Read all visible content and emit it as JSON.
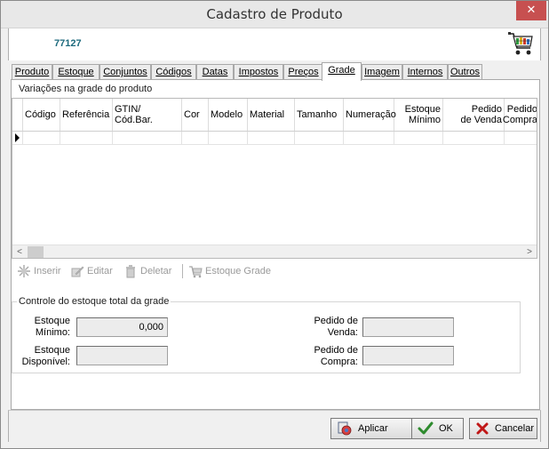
{
  "window": {
    "title": "Cadastro de Produto",
    "close_glyph": "✕"
  },
  "header": {
    "product_code": "77127",
    "icon": "shopping-cart-icon"
  },
  "tabs": [
    {
      "label": "Produto",
      "active": false
    },
    {
      "label": "Estoque",
      "active": false
    },
    {
      "label": "Conjuntos",
      "active": false
    },
    {
      "label": "Códigos",
      "active": false
    },
    {
      "label": "Datas",
      "active": false
    },
    {
      "label": "Impostos",
      "active": false
    },
    {
      "label": "Preços",
      "active": false
    },
    {
      "label": "Grade",
      "active": true
    },
    {
      "label": "Imagem",
      "active": false
    },
    {
      "label": "Internos",
      "active": false
    },
    {
      "label": "Outros",
      "active": false
    }
  ],
  "variations": {
    "group_title": "Variações na grade do produto",
    "columns": [
      {
        "label": "Código"
      },
      {
        "label": "Referência"
      },
      {
        "label": "GTIN/\nCód.Bar."
      },
      {
        "label": "Cor"
      },
      {
        "label": "Modelo"
      },
      {
        "label": "Material"
      },
      {
        "label": "Tamanho"
      },
      {
        "label": "Numeração"
      },
      {
        "label": "Estoque\nMínimo"
      },
      {
        "label": "Pedido\nde Venda"
      },
      {
        "label": "Pedido\nCompra"
      }
    ],
    "rows": [
      {
        "cells": [
          "",
          "",
          "",
          "",
          "",
          "",
          "",
          "",
          "",
          "",
          ""
        ]
      }
    ],
    "scroll_left": "<",
    "scroll_right": ">"
  },
  "toolbar": {
    "insert_label": "Inserir",
    "edit_label": "Editar",
    "delete_label": "Deletar",
    "stock_grade_label": "Estoque Grade"
  },
  "stock_control": {
    "group_title": "Controle do estoque total da grade",
    "min_stock_label": "Estoque\nMínimo:",
    "min_stock_value": "0,000",
    "available_stock_label": "Estoque\nDisponível:",
    "available_stock_value": "",
    "sales_order_label": "Pedido de\nVenda:",
    "sales_order_value": "",
    "purchase_order_label": "Pedido de\nCompra:",
    "purchase_order_value": ""
  },
  "footer": {
    "apply_label": "Aplicar",
    "ok_label": "OK",
    "cancel_label": "Cancelar"
  },
  "colors": {
    "product_code": "#1d6a7d",
    "close_button": "#c75050",
    "ok_check": "#2e8b2e",
    "cancel_x": "#c01818"
  }
}
